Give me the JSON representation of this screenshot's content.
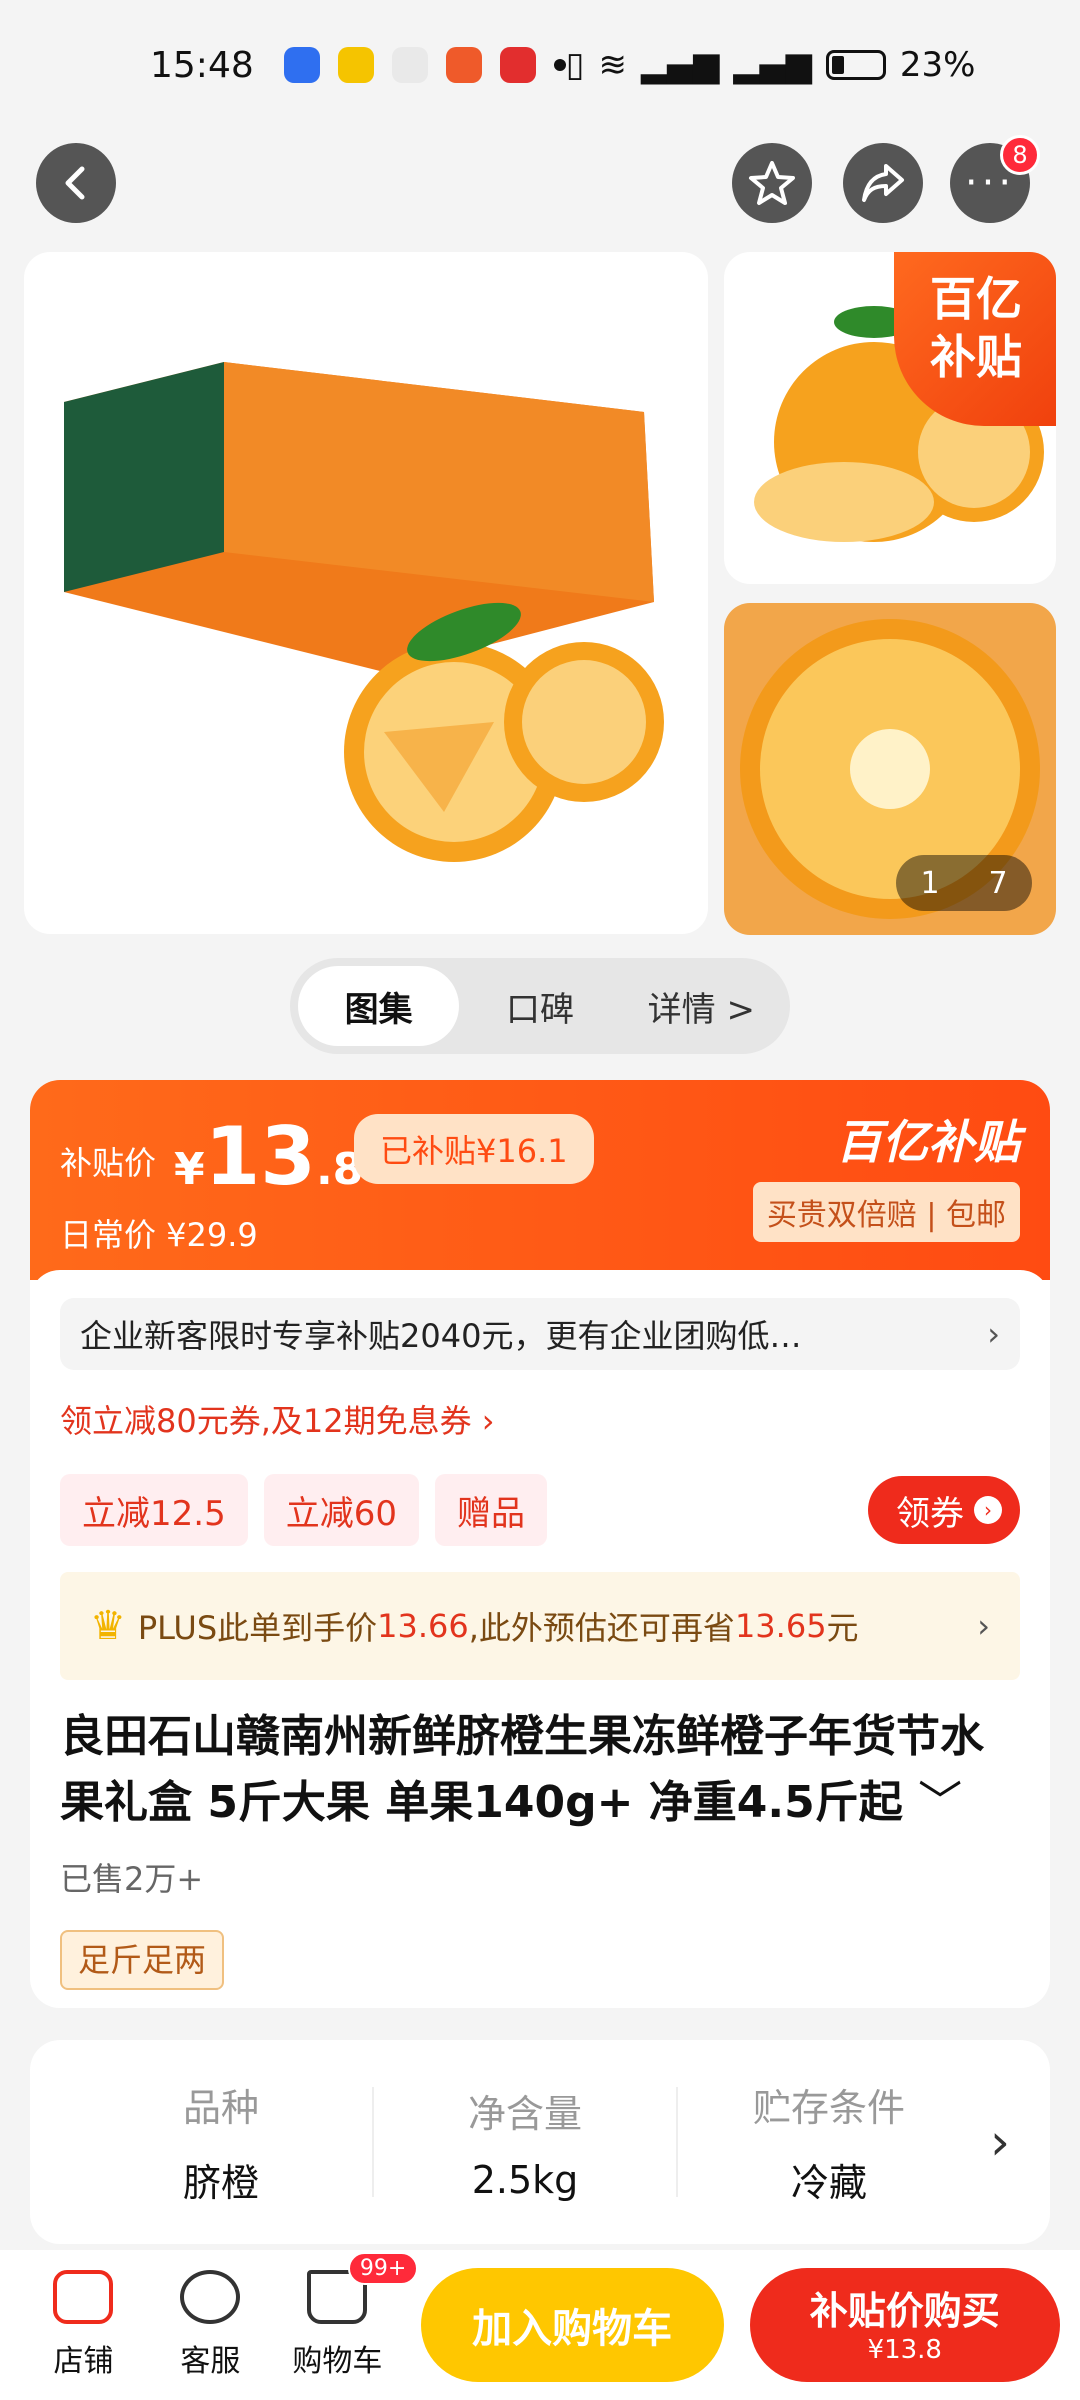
{
  "status_bar": {
    "time": "15:48",
    "battery": "23%"
  },
  "nav": {
    "more_badge": "8"
  },
  "gallery": {
    "current": "1",
    "total": "7",
    "subsidy_corner": "百亿补贴"
  },
  "tabs": [
    {
      "label": "图集"
    },
    {
      "label": "口碑"
    },
    {
      "label": "详情 >"
    }
  ],
  "price": {
    "subsidy_label": "补贴价",
    "currency": "¥",
    "integer": "13",
    "decimal": ".8",
    "subsidized_pill": "已补贴¥16.1",
    "daily_price": "日常价 ¥29.9",
    "brand": "百亿补贴",
    "guarantee": "买贵双倍赔 | 包邮"
  },
  "promo": {
    "enterprise": "企业新客限时专享补贴2040元，更有企业团购低…",
    "coupon_line": "领立减80元券,及12期免息券 ›",
    "chips": [
      "立减12.5",
      "立减60",
      "赠品"
    ],
    "coupon_button": "领券",
    "plus_prefix": "PLUS此单到手价",
    "plus_price": "13.66",
    "plus_middle": ",此外预估还可再省",
    "plus_save": "13.65",
    "plus_suffix": "元"
  },
  "product": {
    "title": "良田石山赣南州新鲜脐橙生果冻鲜橙子年货节水果礼盒 5斤大果 单果140g+ 净重4.5斤起",
    "sold": "已售2万+",
    "tag": "足斤足两"
  },
  "specs": [
    {
      "key": "品种",
      "value": "脐橙"
    },
    {
      "key": "净含量",
      "value": "2.5kg"
    },
    {
      "key": "贮存条件",
      "value": "冷藏"
    }
  ],
  "bottom_bar": {
    "store": "店铺",
    "service": "客服",
    "cart": "购物车",
    "cart_badge": "99+",
    "add_cart": "加入购物车",
    "buy_line1": "补贴价购买",
    "buy_line2": "¥13.8"
  },
  "colors": {
    "accent": "#ff4b12",
    "buy": "#ef2b1c",
    "cart": "#ffc700"
  }
}
